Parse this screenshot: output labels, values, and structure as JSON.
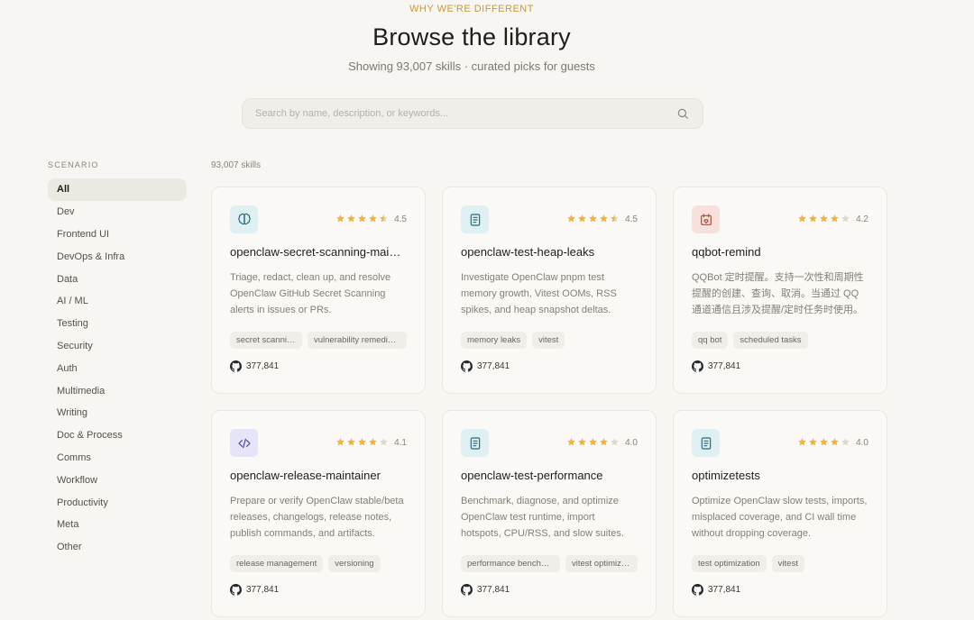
{
  "header": {
    "eyebrow": "WHY WE'RE DIFFERENT",
    "title": "Browse the library",
    "subtitle": "Showing 93,007 skills · curated picks for guests"
  },
  "search": {
    "placeholder": "Search by name, description, or keywords...",
    "value": ""
  },
  "sidebar": {
    "heading": "SCENARIO",
    "items": [
      {
        "label": "All",
        "active": true
      },
      {
        "label": "Dev"
      },
      {
        "label": "Frontend UI"
      },
      {
        "label": "DevOps & Infra"
      },
      {
        "label": "Data"
      },
      {
        "label": "AI / ML"
      },
      {
        "label": "Testing"
      },
      {
        "label": "Security"
      },
      {
        "label": "Auth"
      },
      {
        "label": "Multimedia"
      },
      {
        "label": "Writing"
      },
      {
        "label": "Doc & Process"
      },
      {
        "label": "Comms"
      },
      {
        "label": "Workflow"
      },
      {
        "label": "Productivity"
      },
      {
        "label": "Meta"
      },
      {
        "label": "Other"
      }
    ]
  },
  "results": {
    "count_label": "93,007 skills"
  },
  "colors": {
    "star_filled": "#f0b43c",
    "star_empty": "#dcd8d0",
    "accent": "#c9983a"
  },
  "cards": [
    {
      "icon": "brain-icon",
      "icon_bg": "#dff0f3",
      "icon_color": "#2a6a78",
      "rating": 4.5,
      "rating_label": "4.5",
      "title": "openclaw-secret-scanning-maintainer",
      "description": "Triage, redact, clean up, and resolve OpenClaw GitHub Secret Scanning alerts in issues or PRs.",
      "tags": [
        "secret scanning",
        "vulnerability remediation"
      ],
      "stars_label": "377,841"
    },
    {
      "icon": "document-icon",
      "icon_bg": "#dff0f3",
      "icon_color": "#2a6a78",
      "rating": 4.5,
      "rating_label": "4.5",
      "title": "openclaw-test-heap-leaks",
      "description": "Investigate OpenClaw pnpm test memory growth, Vitest OOMs, RSS spikes, and heap snapshot deltas.",
      "tags": [
        "memory leaks",
        "vitest"
      ],
      "stars_label": "377,841"
    },
    {
      "icon": "calendar-heart-icon",
      "icon_bg": "#f8e1dc",
      "icon_color": "#b04a3a",
      "rating": 4.2,
      "rating_label": "4.2",
      "title": "qqbot-remind",
      "description": "QQBot 定时提醒。支持一次性和周期性提醒的创建、查询、取消。当通过 QQ 通道通信且涉及提醒/定时任务时使用。",
      "tags": [
        "qq bot",
        "scheduled tasks"
      ],
      "stars_label": "377,841"
    },
    {
      "icon": "code-icon",
      "icon_bg": "#e6e4f8",
      "icon_color": "#4a44a8",
      "rating": 4.1,
      "rating_label": "4.1",
      "title": "openclaw-release-maintainer",
      "description": "Prepare or verify OpenClaw stable/beta releases, changelogs, release notes, publish commands, and artifacts.",
      "tags": [
        "release management",
        "versioning"
      ],
      "stars_label": "377,841"
    },
    {
      "icon": "document-icon",
      "icon_bg": "#dff0f3",
      "icon_color": "#2a6a78",
      "rating": 4.0,
      "rating_label": "4.0",
      "title": "openclaw-test-performance",
      "description": "Benchmark, diagnose, and optimize OpenClaw test runtime, import hotspots, CPU/RSS, and slow suites.",
      "tags": [
        "performance benchmarking",
        "vitest optimization"
      ],
      "stars_label": "377,841"
    },
    {
      "icon": "document-icon",
      "icon_bg": "#dff0f3",
      "icon_color": "#2a6a78",
      "rating": 4.0,
      "rating_label": "4.0",
      "title": "optimizetests",
      "description": "Optimize OpenClaw slow tests, imports, misplaced coverage, and CI wall time without dropping coverage.",
      "tags": [
        "test optimization",
        "vitest"
      ],
      "stars_label": "377,841"
    }
  ]
}
